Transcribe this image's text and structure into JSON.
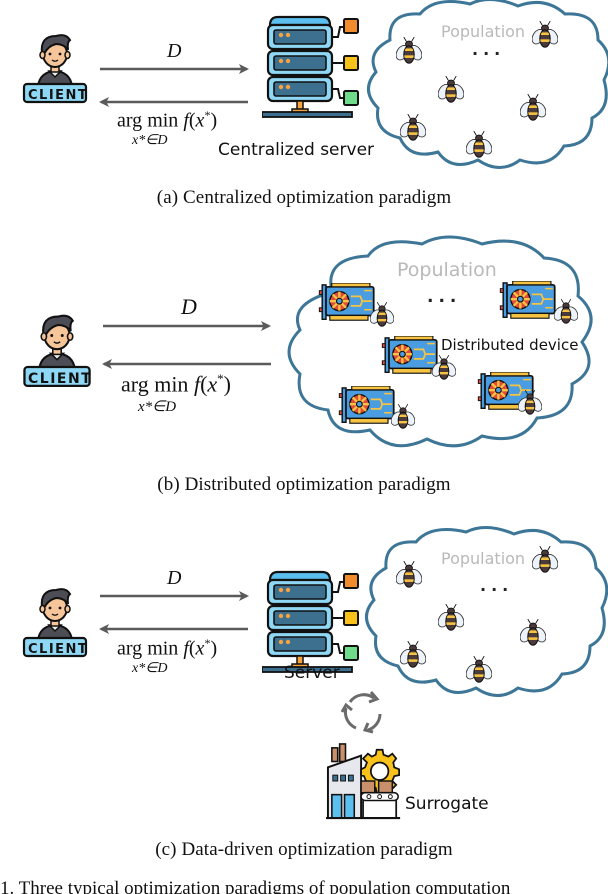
{
  "panels": [
    {
      "id": "a",
      "caption": "(a)  Centralized optimization paradigm",
      "client_label": "CLIENT",
      "forward_arrow_label": "D",
      "return_arrow_label": {
        "main": "arg min f(x*)",
        "arg": "arg",
        "min": "min",
        "func": "f",
        "paren_open": "(",
        "var": "x",
        "star": "*",
        "paren_close": ")",
        "subscript": "x*∈D"
      },
      "server_label": "Centralized server",
      "cloud_label": "Population",
      "ellipsis": "...",
      "bee_count": 6
    },
    {
      "id": "b",
      "caption": "(b)  Distributed optimization paradigm",
      "client_label": "CLIENT",
      "forward_arrow_label": "D",
      "return_arrow_label": {
        "main": "arg min f(x*)",
        "arg": "arg",
        "min": "min",
        "func": "f",
        "paren_open": "(",
        "var": "x",
        "star": "*",
        "paren_close": ")",
        "subscript": "x*∈D"
      },
      "cloud_label": "Population",
      "ellipsis": "...",
      "device_label": "Distributed device",
      "device_count": 5
    },
    {
      "id": "c",
      "caption": "(c)  Data-driven optimization paradigm",
      "client_label": "CLIENT",
      "forward_arrow_label": "D",
      "return_arrow_label": {
        "main": "arg min f(x*)",
        "arg": "arg",
        "min": "min",
        "func": "f",
        "paren_open": "(",
        "var": "x",
        "star": "*",
        "paren_close": ")",
        "subscript": "x*∈D"
      },
      "server_label": "Server",
      "cloud_label": "Population",
      "ellipsis": "...",
      "surrogate_label": "Surrogate",
      "bee_count": 6
    }
  ],
  "figure_caption_partial": "1.   Three typical optimization paradigms of population computation",
  "colors": {
    "arrow": "#5a5a5a",
    "cloud_stroke": "#3d7696",
    "population_text": "#b9b9b9",
    "client_badge": "#8fd8f5",
    "server_top": "#5bc0f0",
    "server_body": "#3d6f8f",
    "square_orange": "#f28a2e",
    "square_yellow": "#f8c21b",
    "square_green": "#6fdc8c",
    "gpu_blue": "#4a9de0",
    "bee_body": "#4a3a3a",
    "bee_stripe": "#f6c343"
  }
}
